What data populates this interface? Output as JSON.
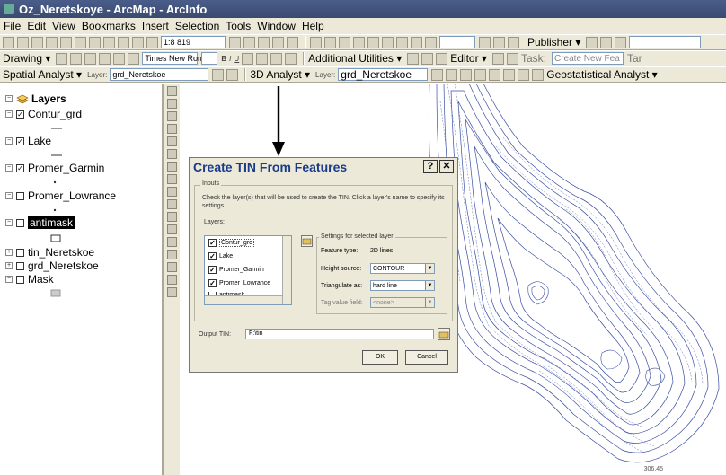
{
  "window": {
    "title": "Oz_Neretskoye - ArcMap - ArcInfo"
  },
  "menu": [
    "File",
    "Edit",
    "View",
    "Bookmarks",
    "Insert",
    "Selection",
    "Tools",
    "Window",
    "Help"
  ],
  "toolbar1": {
    "scale": "1:8 819",
    "publisher_label": "Publisher ▾"
  },
  "toolbar2": {
    "drawing_label": "Drawing ▾",
    "font_name": "Times New Roman",
    "bold": "B",
    "italic": "I",
    "underline": "U",
    "additional_label": "Additional Utilities ▾",
    "editor_label": "Editor ▾",
    "task_label": "Task:",
    "task_value": "Create New Fea",
    "target_label": "Tar"
  },
  "toolbar3": {
    "spatial_label": "Spatial Analyst ▾",
    "layer_label": "Layer:",
    "spatial_layer": "grd_Neretskoe",
    "analyst3d_label": "3D Analyst ▾",
    "analyst3d_layer_label": "Layer:",
    "analyst3d_layer": "grd_Neretskoe",
    "geostat_label": "Geostatistical Analyst ▾"
  },
  "toc": {
    "root": "Layers",
    "layers": [
      {
        "name": "Contur_grd",
        "checked": "✓"
      },
      {
        "name": "Lake",
        "checked": "✓"
      },
      {
        "name": "Promer_Garmin",
        "checked": "✓"
      },
      {
        "name": "Promer_Lowrance",
        "checked": ""
      },
      {
        "name": "antimask",
        "checked": ""
      },
      {
        "name": "tin_Neretskoe",
        "checked": ""
      },
      {
        "name": "grd_Neretskoe",
        "checked": ""
      },
      {
        "name": "Mask",
        "checked": ""
      }
    ]
  },
  "dialog": {
    "title": "Create TIN From Features",
    "help": "?",
    "close": "✕",
    "inputs_label": "Inputs",
    "instructions": "Check the layer(s) that will be used to create the TIN. Click a layer's name to specify its settings.",
    "layers_label": "Layers:",
    "layer_items": [
      {
        "name": "Contur_grd",
        "checked": "✓"
      },
      {
        "name": "Lake",
        "checked": "✓"
      },
      {
        "name": "Promer_Garmin",
        "checked": "✓"
      },
      {
        "name": "Promer_Lowrance",
        "checked": "✓"
      },
      {
        "name": "antimask",
        "checked": ""
      }
    ],
    "settings_label": "Settings for selected layer",
    "feature_type_label": "Feature type:",
    "feature_type_value": "2D lines",
    "height_source_label": "Height source:",
    "height_source_value": "CONTOUR",
    "triangulate_label": "Triangulate as:",
    "triangulate_value": "hard line",
    "tag_label": "Tag value field:",
    "tag_value": "<none>",
    "output_label": "Output TIN:",
    "output_value": "F:\\tin",
    "ok": "OK",
    "cancel": "Cancel"
  },
  "map": {
    "coordinate": "306.45"
  },
  "colors": {
    "title_bar": "#3a4a70",
    "contour": "#3a4fa0",
    "dialog_title": "#1a3b8a"
  }
}
